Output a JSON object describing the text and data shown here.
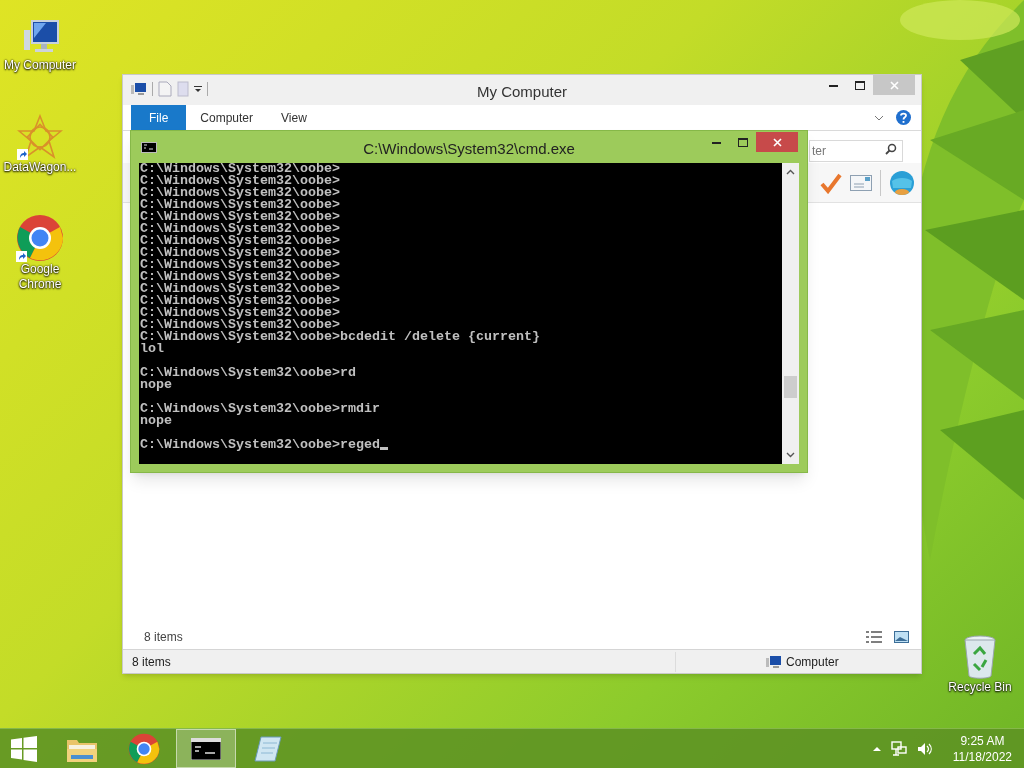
{
  "desktop_icons": [
    {
      "kind": "computer",
      "label": "My Computer",
      "shortcut": false
    },
    {
      "kind": "star",
      "label": "DataWagon...",
      "shortcut": true
    },
    {
      "kind": "chrome",
      "label": "Google Chrome",
      "shortcut": true
    },
    {
      "kind": "recycle",
      "label": "Recycle Bin",
      "shortcut": false
    }
  ],
  "explorer": {
    "title": "My Computer",
    "ribbon_tabs": [
      {
        "label": "File",
        "kind": "menu"
      },
      {
        "label": "Computer",
        "kind": "tab"
      },
      {
        "label": "View",
        "kind": "tab"
      }
    ],
    "search": {
      "placeholder": "ter"
    },
    "item_count": "8 items",
    "status_bar": {
      "items": "8 items",
      "location": "Computer"
    }
  },
  "console": {
    "title": "C:\\Windows\\System32\\cmd.exe",
    "blocks": [
      [
        "C:\\Windows\\System32\\oobe>",
        "C:\\Windows\\System32\\oobe>",
        "C:\\Windows\\System32\\oobe>",
        "C:\\Windows\\System32\\oobe>",
        "C:\\Windows\\System32\\oobe>",
        "C:\\Windows\\System32\\oobe>",
        "C:\\Windows\\System32\\oobe>",
        "C:\\Windows\\System32\\oobe>",
        "C:\\Windows\\System32\\oobe>",
        "C:\\Windows\\System32\\oobe>",
        "C:\\Windows\\System32\\oobe>",
        "C:\\Windows\\System32\\oobe>",
        "C:\\Windows\\System32\\oobe>",
        "C:\\Windows\\System32\\oobe>",
        "C:\\Windows\\System32\\oobe>bcdedit /delete {current}",
        "lol"
      ],
      [
        "C:\\Windows\\System32\\oobe>rd",
        "nope"
      ],
      [
        "C:\\Windows\\System32\\oobe>rmdir",
        "nope"
      ],
      [
        "C:\\Windows\\System32\\oobe>reged"
      ]
    ]
  },
  "taskbar": {
    "items": [
      {
        "kind": "explorer",
        "selected": false
      },
      {
        "kind": "chrome",
        "selected": false
      },
      {
        "kind": "console",
        "selected": true
      },
      {
        "kind": "notepad",
        "selected": false
      }
    ],
    "clock": {
      "time": "9:25 AM",
      "date": "11/18/2022"
    }
  }
}
